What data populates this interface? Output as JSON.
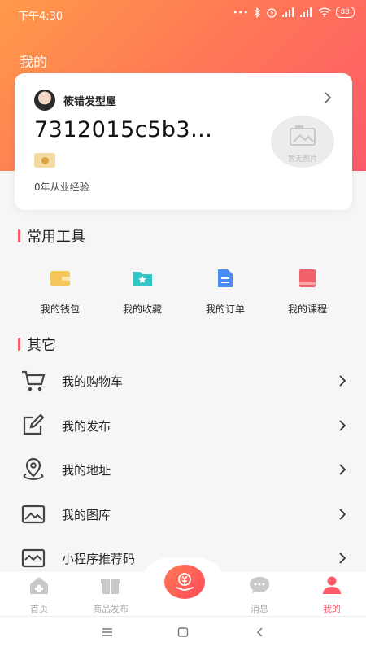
{
  "status_bar": {
    "time": "下午4:30",
    "dots": "•••",
    "battery": "83"
  },
  "page": {
    "title": "我的"
  },
  "profile": {
    "shop_name": "筱错发型屋",
    "user_id": "7312015c5b3...",
    "experience": "0年从业经验",
    "no_image_label": "暂无图片"
  },
  "tools_section": {
    "title": "常用工具",
    "items": [
      {
        "label": "我的钱包",
        "icon": "wallet-icon",
        "color": "#f7c65a"
      },
      {
        "label": "我的收藏",
        "icon": "favorites-folder-icon",
        "color": "#34c6c6"
      },
      {
        "label": "我的订单",
        "icon": "order-document-icon",
        "color": "#4a8cf5"
      },
      {
        "label": "我的课程",
        "icon": "course-book-icon",
        "color": "#f2606a"
      }
    ]
  },
  "other_section": {
    "title": "其它",
    "items": [
      {
        "label": "我的购物车",
        "icon": "shopping-cart-icon"
      },
      {
        "label": "我的发布",
        "icon": "edit-icon"
      },
      {
        "label": "我的地址",
        "icon": "location-pin-icon"
      },
      {
        "label": "我的图库",
        "icon": "image-gallery-icon"
      },
      {
        "label": "小程序推荐码",
        "icon": "qr-recommend-icon"
      }
    ]
  },
  "tab_bar": {
    "items": [
      {
        "label": "首页",
        "icon": "home-icon",
        "active": false
      },
      {
        "label": "商品发布",
        "icon": "gift-icon",
        "active": false
      },
      {
        "label": "消息",
        "icon": "chat-icon",
        "active": false
      },
      {
        "label": "我的",
        "icon": "user-icon",
        "active": true
      }
    ],
    "center_icon": "yen-hand-icon"
  },
  "colors": {
    "accent": "#ff5a6a",
    "gradient_start": "#ff9a4a",
    "gradient_end": "#ff5a6a"
  }
}
